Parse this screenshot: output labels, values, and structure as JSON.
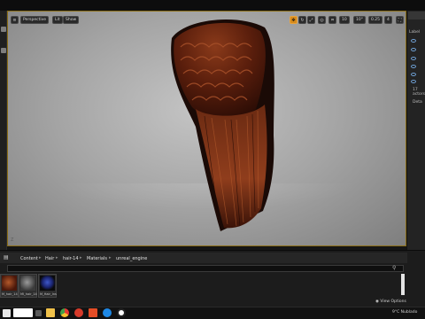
{
  "viewport": {
    "perspective_label": "Perspective",
    "lit_label": "Lit",
    "show_label": "Show",
    "grid_value": "10",
    "angle_value": "10°",
    "scale_value": "0.25",
    "camera_speed": "4",
    "axis_label": "Z"
  },
  "outliner": {
    "label_prefix": "Label",
    "items_count": "17 actors",
    "details_tab": "Deta"
  },
  "content_browser": {
    "breadcrumbs": [
      "Content",
      "Hair",
      "hair-14",
      "Materials",
      "unreal_engine"
    ],
    "assets": [
      {
        "label": "M_hair_14"
      },
      {
        "label": "MI_hair_14"
      },
      {
        "label": "M_Hair_Inst"
      }
    ],
    "view_options_label": "View Options"
  },
  "taskbar": {
    "tray_text": "9°C  Nublado"
  },
  "colors": {
    "viewport_border": "#8a6d16",
    "active_button": "#d58a1c",
    "hair_base": "#5a1e0c",
    "hair_highlight": "#9c4a24"
  },
  "icons": {
    "search": "search-icon",
    "eye": "visibility-eye-icon",
    "windows": "windows-start-icon",
    "unreal": "unreal-engine-icon"
  }
}
